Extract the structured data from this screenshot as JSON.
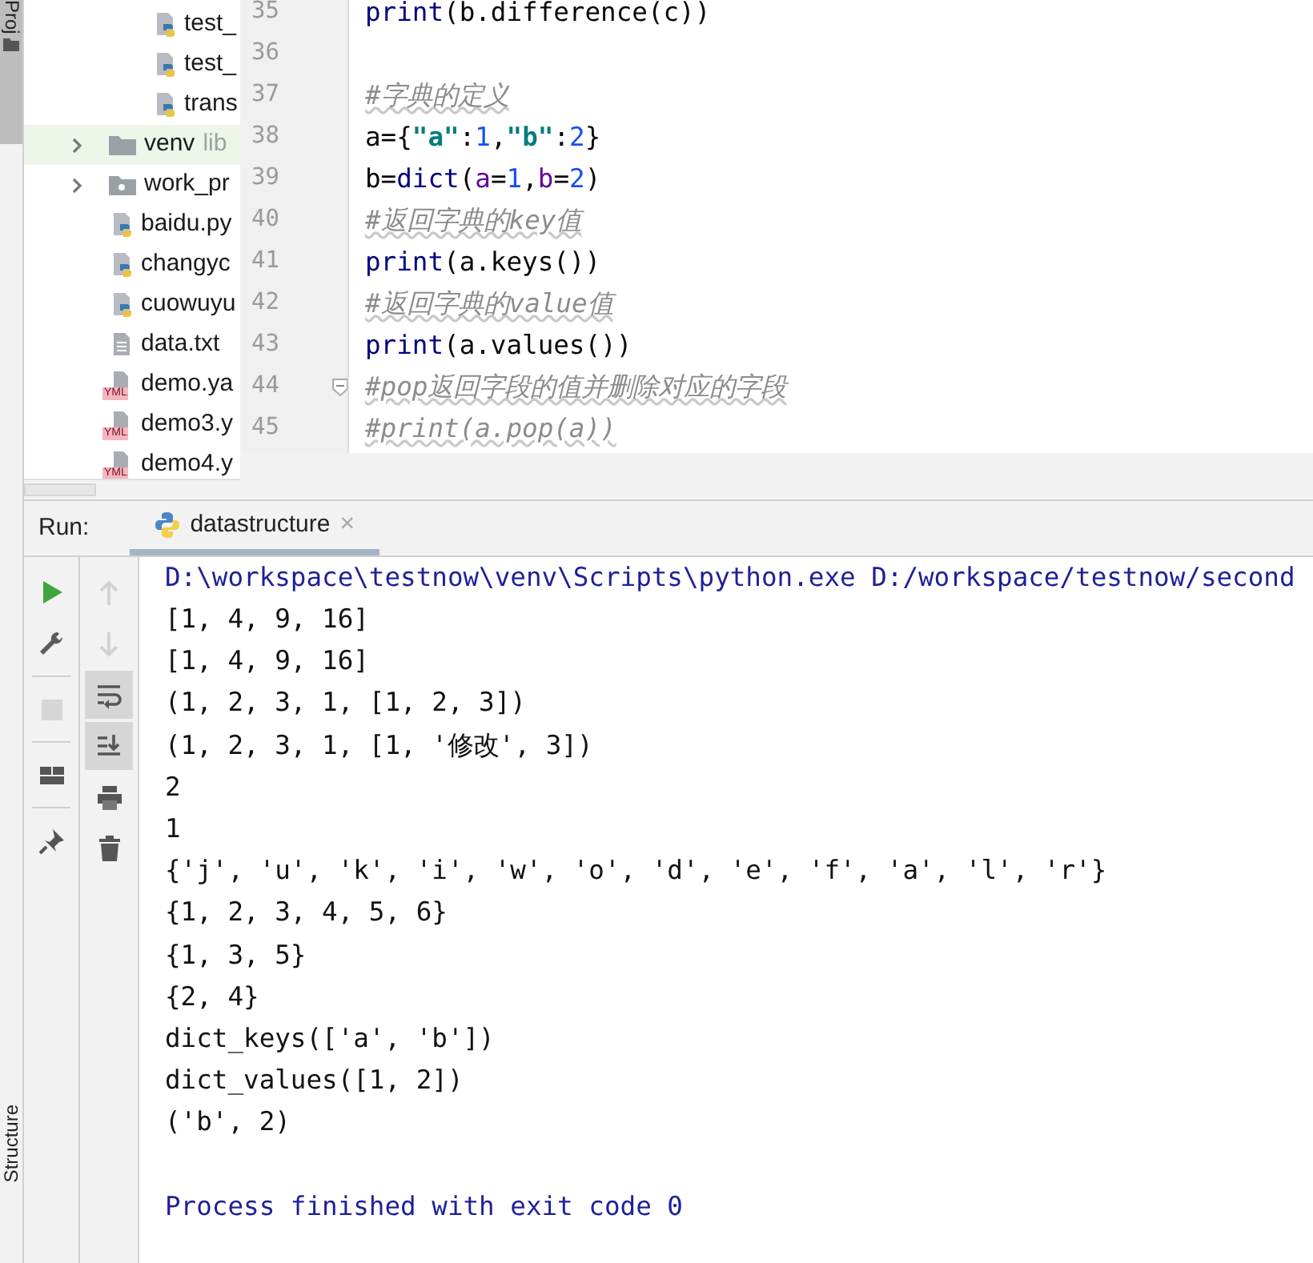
{
  "side_strip": {
    "top_tab": "Proj",
    "bottom_tab": "Structure"
  },
  "project_tree": [
    {
      "kind": "python",
      "label": "test_",
      "highlighted": false
    },
    {
      "kind": "python",
      "label": "test_",
      "highlighted": false
    },
    {
      "kind": "python",
      "label": "trans",
      "highlighted": false
    },
    {
      "kind": "folder",
      "label": "venv",
      "note": "lib",
      "expanded": false,
      "highlighted": true
    },
    {
      "kind": "package",
      "label": "work_pr",
      "expanded": false,
      "highlighted": false
    },
    {
      "kind": "python",
      "label": "baidu.py",
      "highlighted": false
    },
    {
      "kind": "python",
      "label": "changyc",
      "highlighted": false
    },
    {
      "kind": "python",
      "label": "cuowuyu",
      "highlighted": false
    },
    {
      "kind": "text",
      "label": "data.txt",
      "highlighted": false
    },
    {
      "kind": "yaml",
      "label": "demo.ya",
      "badge": "YML",
      "highlighted": false
    },
    {
      "kind": "yaml",
      "label": "demo3.y",
      "badge": "YML",
      "highlighted": false
    },
    {
      "kind": "yaml",
      "label": "demo4.y",
      "badge": "YML",
      "highlighted": false
    }
  ],
  "editor": {
    "lines": [
      {
        "number": "35",
        "tokens": [
          {
            "kind": "builtin",
            "text": "print"
          },
          {
            "kind": "plain",
            "text": "(b.difference(c))"
          }
        ]
      },
      {
        "number": "36"
      },
      {
        "number": "37",
        "tokens": [
          {
            "kind": "comment",
            "text": "#字典的定义"
          }
        ]
      },
      {
        "number": "38",
        "tokens": [
          {
            "kind": "plain",
            "text": "a={"
          },
          {
            "kind": "string",
            "text": "\"a\""
          },
          {
            "kind": "plain",
            "text": ":"
          },
          {
            "kind": "number",
            "text": "1"
          },
          {
            "kind": "plain",
            "text": ","
          },
          {
            "kind": "string",
            "text": "\"b\""
          },
          {
            "kind": "plain",
            "text": ":"
          },
          {
            "kind": "number",
            "text": "2"
          },
          {
            "kind": "plain",
            "text": "}"
          }
        ]
      },
      {
        "number": "39",
        "tokens": [
          {
            "kind": "plain",
            "text": "b="
          },
          {
            "kind": "builtin",
            "text": "dict"
          },
          {
            "kind": "plain",
            "text": "("
          },
          {
            "kind": "param",
            "text": "a"
          },
          {
            "kind": "plain",
            "text": "="
          },
          {
            "kind": "number",
            "text": "1"
          },
          {
            "kind": "plain",
            "text": ","
          },
          {
            "kind": "param",
            "text": "b"
          },
          {
            "kind": "plain",
            "text": "="
          },
          {
            "kind": "number",
            "text": "2"
          },
          {
            "kind": "plain",
            "text": ")"
          }
        ]
      },
      {
        "number": "40",
        "tokens": [
          {
            "kind": "comment",
            "text": "#返回字典的key值"
          }
        ]
      },
      {
        "number": "41",
        "tokens": [
          {
            "kind": "builtin",
            "text": "print"
          },
          {
            "kind": "plain",
            "text": "(a.keys())"
          }
        ]
      },
      {
        "number": "42",
        "tokens": [
          {
            "kind": "comment",
            "text": "#返回字典的value值"
          }
        ]
      },
      {
        "number": "43",
        "tokens": [
          {
            "kind": "builtin",
            "text": "print"
          },
          {
            "kind": "plain",
            "text": "(a.values())"
          }
        ]
      },
      {
        "number": "44",
        "fold": true,
        "tokens": [
          {
            "kind": "comment",
            "text": "#pop返回字段的值并删除对应的字段"
          }
        ]
      },
      {
        "number": "45",
        "tokens": [
          {
            "kind": "comment",
            "text": "#print(a.pop(a))"
          }
        ]
      }
    ]
  },
  "run_panel": {
    "label": "Run:",
    "tab": {
      "title": "datastructure",
      "close": "×"
    },
    "left_tools": [
      {
        "kind": "run",
        "disabled": false
      },
      {
        "kind": "wrench",
        "disabled": false
      },
      {
        "kind": "stop",
        "disabled": true
      },
      {
        "kind": "layout",
        "disabled": false
      },
      {
        "kind": "pin",
        "disabled": false
      }
    ],
    "right_tools": [
      {
        "kind": "up",
        "disabled": true,
        "toggled": false
      },
      {
        "kind": "down",
        "disabled": true,
        "toggled": false
      },
      {
        "kind": "wrap",
        "disabled": false,
        "toggled": true
      },
      {
        "kind": "scroll-end",
        "disabled": false,
        "toggled": true
      },
      {
        "kind": "print",
        "disabled": false,
        "toggled": false
      },
      {
        "kind": "trash",
        "disabled": false,
        "toggled": false
      }
    ],
    "output": [
      {
        "kind": "system",
        "text": "D:\\workspace\\testnow\\venv\\Scripts\\python.exe D:/workspace/testnow/second"
      },
      {
        "kind": "stdout",
        "text": "[1, 4, 9, 16]"
      },
      {
        "kind": "stdout",
        "text": "[1, 4, 9, 16]"
      },
      {
        "kind": "stdout",
        "text": "(1, 2, 3, 1, [1, 2, 3])"
      },
      {
        "kind": "stdout",
        "text": "(1, 2, 3, 1, [1, '修改', 3])"
      },
      {
        "kind": "stdout",
        "text": "2"
      },
      {
        "kind": "stdout",
        "text": "1"
      },
      {
        "kind": "stdout",
        "text": "{'j', 'u', 'k', 'i', 'w', 'o', 'd', 'e', 'f', 'a', 'l', 'r'}"
      },
      {
        "kind": "stdout",
        "text": "{1, 2, 3, 4, 5, 6}"
      },
      {
        "kind": "stdout",
        "text": "{1, 3, 5}"
      },
      {
        "kind": "stdout",
        "text": "{2, 4}"
      },
      {
        "kind": "stdout",
        "text": "dict_keys(['a', 'b'])"
      },
      {
        "kind": "stdout",
        "text": "dict_values([1, 2])"
      },
      {
        "kind": "stdout",
        "text": "('b', 2)"
      },
      {
        "kind": "blank"
      },
      {
        "kind": "system",
        "text": "Process finished with exit code 0"
      }
    ]
  }
}
